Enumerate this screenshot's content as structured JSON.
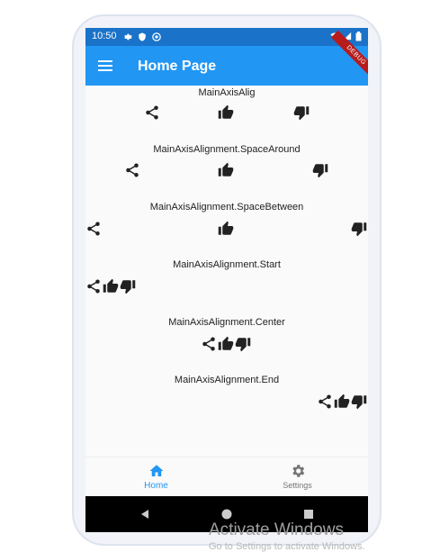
{
  "status_bar": {
    "time": "10:50",
    "icons": [
      "gear-icon",
      "shield-icon",
      "at-icon",
      "wifi-icon",
      "signal-icon",
      "battery-icon"
    ]
  },
  "app_bar": {
    "title": "Home Page",
    "menu_icon": "menu-icon",
    "debug_banner": "DEBUG"
  },
  "sections": [
    {
      "label": "MainAxisAlig"
    },
    {
      "label": "MainAxisAlignment.SpaceAround"
    },
    {
      "label": "MainAxisAlignment.SpaceBetween"
    },
    {
      "label": "MainAxisAlignment.Start"
    },
    {
      "label": "MainAxisAlignment.Center"
    },
    {
      "label": "MainAxisAlignment.End"
    }
  ],
  "section_icons": [
    "share-icon",
    "thumb-up-icon",
    "thumb-down-icon"
  ],
  "bottom_nav": {
    "items": [
      {
        "label": "Home",
        "icon": "home-icon",
        "active": true
      },
      {
        "label": "Settings",
        "icon": "settings-icon",
        "active": false
      }
    ]
  },
  "colors": {
    "app_bar": "#2196f3",
    "status_bar": "#1a72c9",
    "active": "#2196f3",
    "inactive": "#757575"
  },
  "overlay": {
    "watermark_title": "Activate Windows",
    "watermark_sub": "Go to Settings to activate Windows."
  }
}
